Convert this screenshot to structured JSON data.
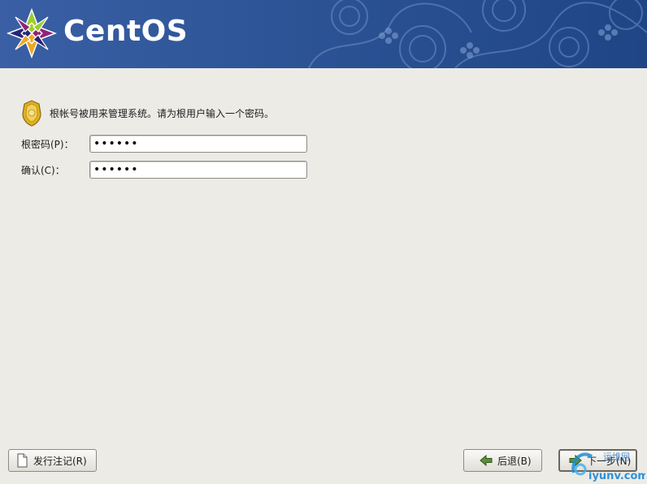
{
  "header": {
    "brand": "CentOS"
  },
  "info": {
    "message": "根帐号被用来管理系统。请为根用户输入一个密码。"
  },
  "form": {
    "root_password": {
      "label": "根密码(P)：",
      "value": "••••••"
    },
    "confirm": {
      "label": "确认(C)：",
      "value": "••••••"
    }
  },
  "buttons": {
    "release_notes": "发行注记(R)",
    "back": "后退(B)",
    "next": "下一步(N)"
  },
  "watermark": {
    "text_top": "运维网",
    "text_bottom": "iyunv.com"
  },
  "colors": {
    "banner": "#2d5597",
    "background": "#edebe6"
  }
}
